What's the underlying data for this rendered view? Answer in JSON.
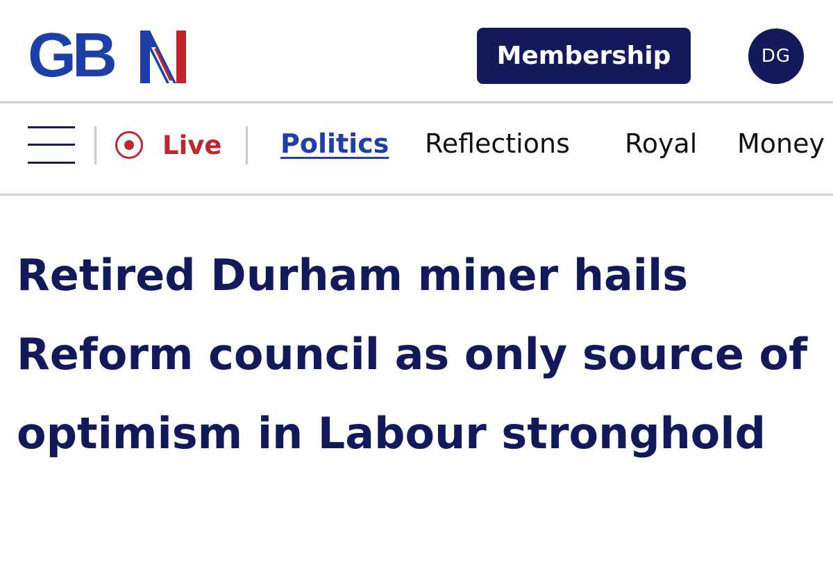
{
  "header": {
    "logo_text": "GBN",
    "membership_label": "Membership",
    "avatar_initials": "DG"
  },
  "nav": {
    "live_label": "Live",
    "items": [
      {
        "label": "Politics",
        "active": true
      },
      {
        "label": "Reflections",
        "active": false
      },
      {
        "label": "Royal",
        "active": false
      },
      {
        "label": "Money",
        "active": false
      }
    ]
  },
  "article": {
    "headline": "Retired Durham miner hails Reform council as only source of optimism in Labour stronghold"
  },
  "colors": {
    "navy": "#131a5c",
    "brand_blue": "#1f3fa8",
    "live_red": "#c0272d"
  },
  "icons": [
    "gbn-logo",
    "hamburger-menu-icon",
    "live-record-icon"
  ]
}
